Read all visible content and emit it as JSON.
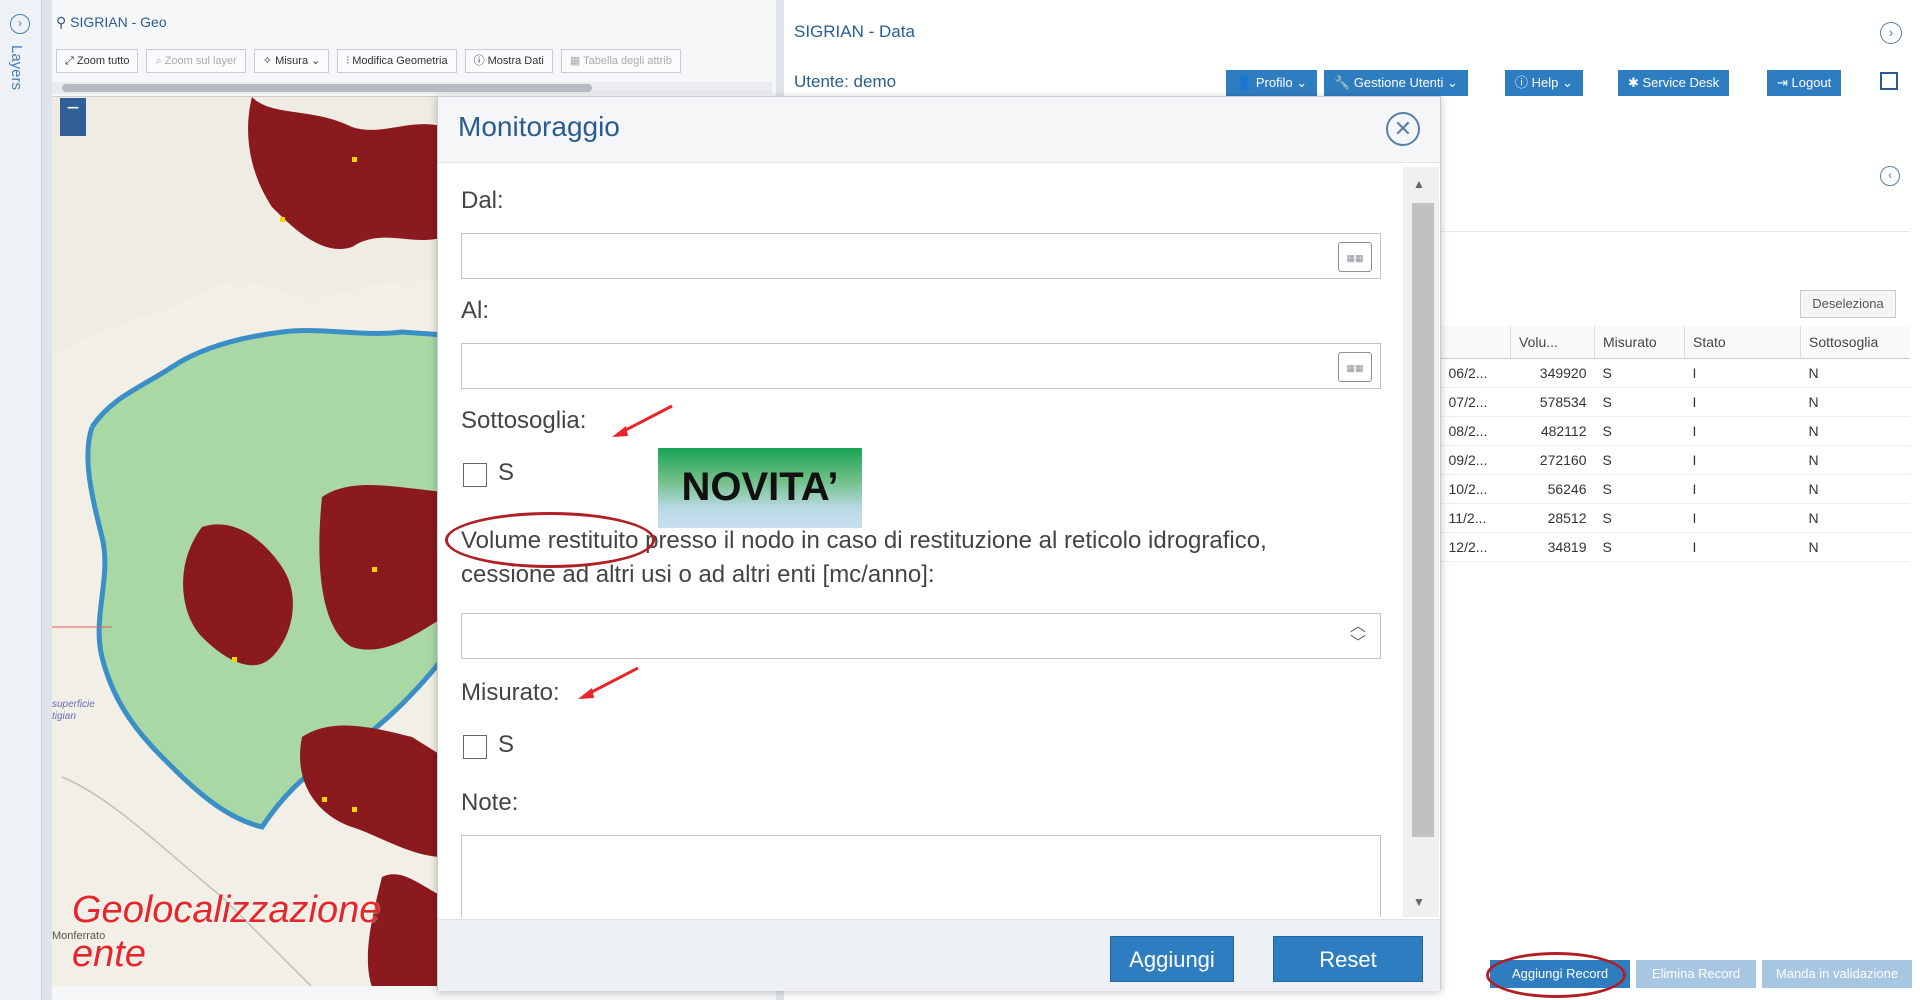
{
  "sidebar": {
    "layers_label": "Layers"
  },
  "geo": {
    "title": "SIGRIAN - Geo",
    "toolbar": [
      {
        "label": "Zoom tutto",
        "enabled": true
      },
      {
        "label": "Zoom sul layer",
        "enabled": false
      },
      {
        "label": "Misura",
        "enabled": true
      },
      {
        "label": "Modifica Geometria",
        "enabled": true
      },
      {
        "label": "Mostra Dati",
        "enabled": true
      },
      {
        "label": "Tabella degli attrib",
        "enabled": false
      }
    ],
    "map_labels": {
      "place1": "superficie",
      "place2": "tigian",
      "place3": "Monferrato"
    }
  },
  "data": {
    "title": "SIGRIAN - Data",
    "user": "Utente: demo",
    "nav": {
      "profilo": "Profilo",
      "gestione": "Gestione Utenti",
      "help": "Help",
      "service": "Service Desk",
      "logout": "Logout"
    },
    "deseleziona": "Deseleziona",
    "columns": [
      "Volu...",
      "Misurato",
      "Stato",
      "Sottosoglia"
    ],
    "rows": [
      {
        "date": "06/2...",
        "vol": "349920",
        "mis": "S",
        "stato": "I",
        "sotto": "N"
      },
      {
        "date": "07/2...",
        "vol": "578534",
        "mis": "S",
        "stato": "I",
        "sotto": "N"
      },
      {
        "date": "08/2...",
        "vol": "482112",
        "mis": "S",
        "stato": "I",
        "sotto": "N"
      },
      {
        "date": "09/2...",
        "vol": "272160",
        "mis": "S",
        "stato": "I",
        "sotto": "N"
      },
      {
        "date": "10/2...",
        "vol": "56246",
        "mis": "S",
        "stato": "I",
        "sotto": "N"
      },
      {
        "date": "11/2...",
        "vol": "28512",
        "mis": "S",
        "stato": "I",
        "sotto": "N"
      },
      {
        "date": "12/2...",
        "vol": "34819",
        "mis": "S",
        "stato": "I",
        "sotto": "N"
      }
    ],
    "bottom": {
      "aggiungi": "Aggiungi Record",
      "elimina": "Elimina Record",
      "manda": "Manda in validazione"
    }
  },
  "dialog": {
    "title": "Monitoraggio",
    "dal": "Dal:",
    "al": "Al:",
    "sottosoglia": "Sottosoglia:",
    "sottosoglia_opt": "S",
    "volume_line1": "Volume restituito presso il nodo in caso di restituzione al reticolo idrografico,",
    "volume_line2": "cessione ad altri usi o ad altri enti [mc/anno]:",
    "misurato": "Misurato:",
    "misurato_opt": "S",
    "note": "Note:",
    "aggiungi": "Aggiungi",
    "reset": "Reset"
  },
  "annotations": {
    "novita": "NOVITA’",
    "geo_line1": "Geolocalizzazione",
    "geo_line2": "ente"
  },
  "colors": {
    "accent": "#2f7dc1",
    "polygon": "#8b1a1f",
    "map_green": "#a9d8a4",
    "river": "#3b8fc7",
    "annotation": "#b01f24"
  }
}
